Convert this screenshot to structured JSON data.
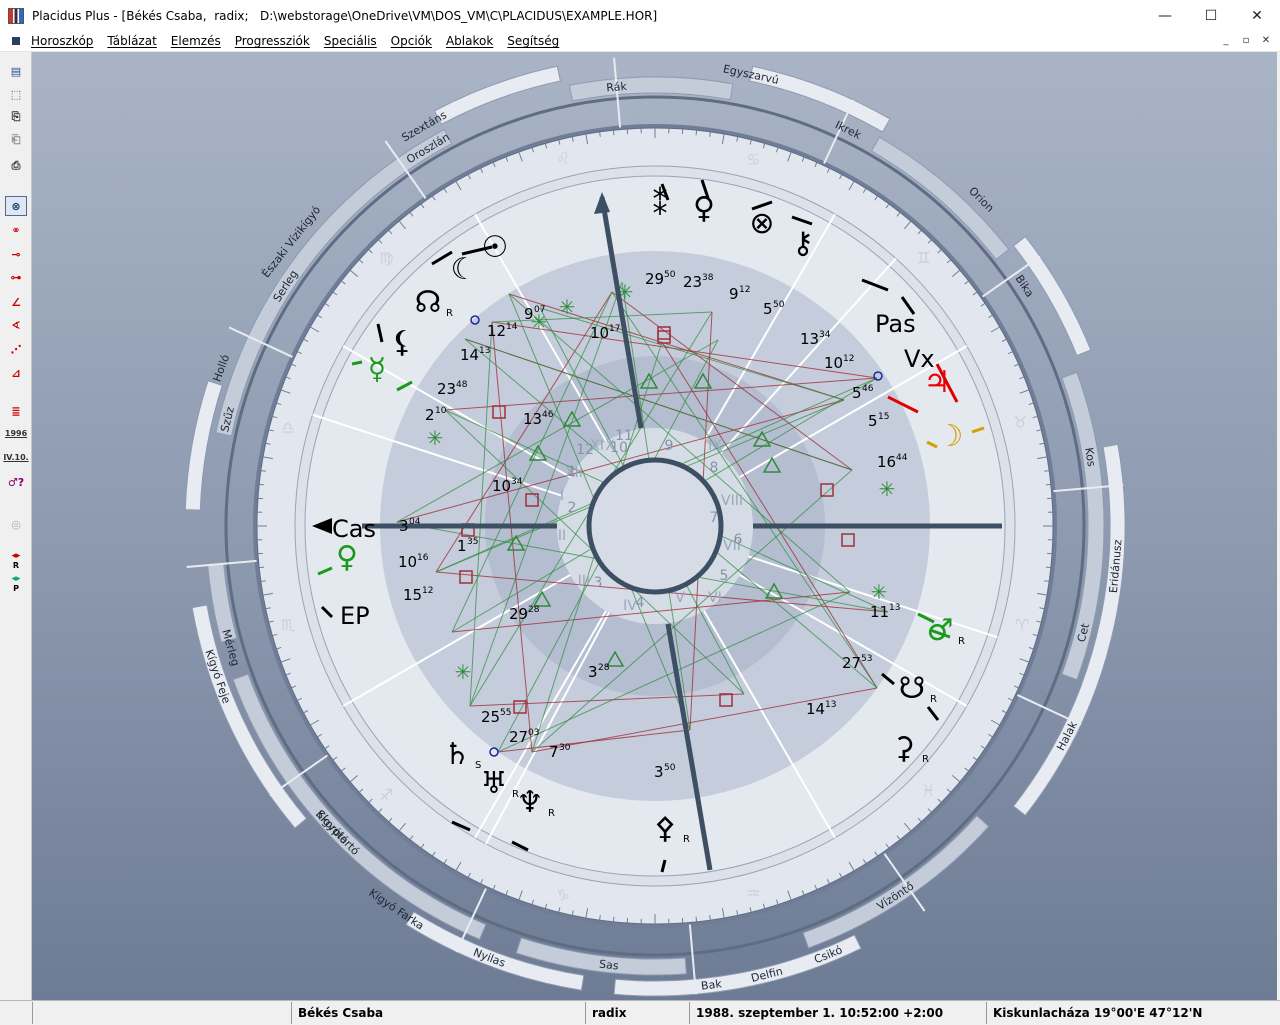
{
  "window": {
    "title": "Placidus Plus - [Békés Csaba,  radix;   D:\\webstorage\\OneDrive\\VM\\DOS_VM\\C\\PLACIDUS\\EXAMPLE.HOR]",
    "minimize_label": "—",
    "maximize_label": "☐",
    "close_label": "✕"
  },
  "menu": {
    "items": [
      "Horoszkóp",
      "Táblázat",
      "Elemzés",
      "Progressziók",
      "Speciális",
      "Opciók",
      "Ablakok",
      "Segítség"
    ],
    "mdi": [
      "_",
      "▫",
      "✕"
    ]
  },
  "toolbar": {
    "tools": [
      {
        "name": "new-document-icon",
        "glyph": "▤",
        "color": "#2b4f8f"
      },
      {
        "name": "select-icon",
        "glyph": "⬚",
        "color": "#2b4f8f"
      },
      {
        "name": "copy-icon",
        "glyph": "⎘",
        "color": "#333"
      },
      {
        "name": "paste-icon",
        "glyph": "⎗",
        "color": "#888"
      },
      {
        "name": "print-icon",
        "glyph": "⎙",
        "color": "#333"
      },
      {
        "name": "radix-chart-icon",
        "glyph": "⊗",
        "color": "#1a3a6a"
      },
      {
        "name": "synastry-icon",
        "glyph": "⚭",
        "color": "#c00"
      },
      {
        "name": "transit-icon",
        "glyph": "⊸",
        "color": "#c00"
      },
      {
        "name": "direction-icon",
        "glyph": "⊶",
        "color": "#c00"
      },
      {
        "name": "angle-icon",
        "glyph": "∠",
        "color": "#c00"
      },
      {
        "name": "progression-icon",
        "glyph": "∢",
        "color": "#c00"
      },
      {
        "name": "composite-icon",
        "glyph": "⋰",
        "color": "#c00"
      },
      {
        "name": "arc-icon",
        "glyph": "⊿",
        "color": "#c00"
      },
      {
        "name": "aspect-table-icon",
        "glyph": "≣",
        "color": "#c00"
      },
      {
        "name": "year-icon",
        "text": "1996"
      },
      {
        "name": "date-icon",
        "text": "IV.10."
      },
      {
        "name": "planet-query-icon",
        "glyph": "♂?",
        "color": "#806"
      },
      {
        "name": "disabled-wheel-icon",
        "glyph": "◎",
        "color": "#aaa"
      },
      {
        "name": "retrograde-icon",
        "glyph": "◂▸",
        "color": "#c00",
        "sub": "R"
      },
      {
        "name": "progressed-icon",
        "glyph": "◂▸",
        "color": "#0a8",
        "sub": "P"
      }
    ]
  },
  "chart": {
    "constellations": {
      "top": [
        {
          "label": "Rák",
          "angle": 95
        },
        {
          "label": "Egyszarvú",
          "angle": 78
        },
        {
          "label": "Ikrek",
          "angle": 64
        },
        {
          "label": "Orion",
          "angle": 45
        },
        {
          "label": "Bika",
          "angle": 33
        },
        {
          "label": "Kos",
          "angle": 9
        },
        {
          "label": "Eridánusz",
          "angle": -5
        },
        {
          "label": "Cet",
          "angle": -14
        },
        {
          "label": "Halak",
          "angle": -27
        },
        {
          "label": "Vízöntő",
          "angle": -57
        },
        {
          "label": "Bak",
          "angle": -83
        },
        {
          "label": "Delfin",
          "angle": -76
        },
        {
          "label": "Csikó",
          "angle": -68
        },
        {
          "label": "Sas",
          "angle": -96
        },
        {
          "label": "Nyilas",
          "angle": -111
        },
        {
          "label": "Kígyó Farka",
          "angle": -124
        },
        {
          "label": "Kígyótartó",
          "angle": -136
        },
        {
          "label": "Skorpió",
          "angle": -137
        },
        {
          "label": "Kígyó Feje",
          "angle": -161
        },
        {
          "label": "Mérleg",
          "angle": -164
        },
        {
          "label": "Szűz",
          "angle": 166
        },
        {
          "label": "Holló",
          "angle": 160
        },
        {
          "label": "Serleg",
          "angle": 147
        },
        {
          "label": "Északi Vízikígyó",
          "angle": 142
        },
        {
          "label": "Oroszlán",
          "angle": 121
        },
        {
          "label": "Szextáns",
          "angle": 120
        }
      ]
    },
    "houses_roman": [
      "X",
      "IX",
      "VIII",
      "VII",
      "VI",
      "V",
      "IV",
      "III",
      "II",
      "I",
      "XII",
      "XI"
    ],
    "houses_inner": [
      "9",
      "8",
      "7",
      "6",
      "5",
      "4",
      "3",
      "2",
      "1",
      "12",
      "11",
      "10"
    ],
    "planets": [
      {
        "name": "neptune-glyph",
        "sym": "♆",
        "color": "#000",
        "deg": "7",
        "min": "30",
        "retro": "R"
      },
      {
        "name": "uranus-glyph",
        "sym": "♅",
        "color": "#000",
        "deg": "27",
        "min": "03",
        "retro": "R"
      },
      {
        "name": "saturn-glyph",
        "sym": "♄",
        "color": "#000",
        "deg": "25",
        "min": "55",
        "retro": "S"
      },
      {
        "name": "pluto-glyph",
        "sym": "♀",
        "color": "#1a9a1a",
        "deg": "10",
        "min": "16"
      },
      {
        "name": "mercury-glyph",
        "sym": "☿",
        "color": "#1a9a1a",
        "deg": "23",
        "min": "48"
      },
      {
        "name": "lilith-glyph",
        "sym": "⚸",
        "color": "#000",
        "deg": "14",
        "min": "13"
      },
      {
        "name": "north-node-glyph",
        "sym": "☊",
        "color": "#000",
        "deg": "12",
        "min": "14",
        "retro": "R"
      },
      {
        "name": "moon-glyph",
        "sym": "☾",
        "color": "#000",
        "deg": "9",
        "min": "07"
      },
      {
        "name": "sun-glyph",
        "sym": "☉",
        "color": "#000",
        "deg": "9",
        "min": "07"
      },
      {
        "name": "chiron-glyph",
        "sym": "⚷",
        "color": "#000",
        "deg": "5",
        "min": "50"
      },
      {
        "name": "pars-fortunae-glyph",
        "sym": "⊗",
        "color": "#000",
        "deg": "23",
        "min": "38"
      },
      {
        "name": "venus-glyph",
        "sym": "♀",
        "color": "#000",
        "deg": "29",
        "min": "50"
      },
      {
        "name": "mc-glyph",
        "sym": "⁑",
        "color": "#000",
        "deg": "10",
        "min": "17"
      },
      {
        "name": "jupiter-glyph",
        "sym": "♃",
        "color": "#e00",
        "deg": "5",
        "min": "46"
      },
      {
        "name": "moon2-glyph",
        "sym": "☽",
        "color": "#d4a000",
        "deg": "16",
        "min": "44"
      },
      {
        "name": "mars-glyph",
        "sym": "♂",
        "color": "#1a9a1a",
        "deg": "11",
        "min": "13",
        "retro": "R"
      },
      {
        "name": "south-node-glyph",
        "sym": "☋",
        "color": "#000",
        "deg": "14",
        "min": "13",
        "retro": "R"
      },
      {
        "name": "asteroid-glyph",
        "sym": "⚳",
        "color": "#000",
        "deg": "27",
        "min": "53",
        "retro": "R"
      },
      {
        "name": "ceres-glyph",
        "sym": "⚴",
        "color": "#000",
        "deg": "3",
        "min": "50",
        "retro": "R"
      }
    ],
    "degree_labels": [
      {
        "deg": "9",
        "min": "07"
      },
      {
        "deg": "12",
        "min": "14"
      },
      {
        "deg": "14",
        "min": "13"
      },
      {
        "deg": "23",
        "min": "48"
      },
      {
        "deg": "2",
        "min": "10"
      },
      {
        "deg": "3",
        "min": "04"
      },
      {
        "deg": "10",
        "min": "16"
      },
      {
        "deg": "15",
        "min": "12"
      },
      {
        "deg": "1",
        "min": "35"
      },
      {
        "deg": "29",
        "min": "28"
      },
      {
        "deg": "25",
        "min": "55"
      },
      {
        "deg": "27",
        "min": "03"
      },
      {
        "deg": "7",
        "min": "30"
      },
      {
        "deg": "3",
        "min": "50"
      },
      {
        "deg": "3",
        "min": "28"
      },
      {
        "deg": "14",
        "min": "13"
      },
      {
        "deg": "27",
        "min": "53"
      },
      {
        "deg": "11",
        "min": "13"
      },
      {
        "deg": "16",
        "min": "44"
      },
      {
        "deg": "5",
        "min": "15"
      },
      {
        "deg": "5",
        "min": "46"
      },
      {
        "deg": "10",
        "min": "12"
      },
      {
        "deg": "13",
        "min": "34"
      },
      {
        "deg": "5",
        "min": "50"
      },
      {
        "deg": "9",
        "min": "12"
      },
      {
        "deg": "23",
        "min": "38"
      },
      {
        "deg": "29",
        "min": "50"
      },
      {
        "deg": "10",
        "min": "17"
      },
      {
        "deg": "13",
        "min": "46"
      },
      {
        "deg": "10",
        "min": "34"
      }
    ],
    "points": {
      "asc": "Cas",
      "pas": "Pas",
      "vx": "Vx",
      "ep": "EP"
    },
    "colors": {
      "green": "#1a9a1a",
      "red": "#e00000",
      "gold": "#d4a000",
      "axis": "#3d4f62",
      "aspect_red": "#a0303a",
      "aspect_green": "#2e8b3a"
    }
  },
  "status": {
    "empty": "",
    "name": "Békés Csaba",
    "type": "radix",
    "datetime": "1988. szeptember 1.  10:52:00 +2:00",
    "place": "Kiskunlacháza  19°00'E  47°12'N"
  }
}
